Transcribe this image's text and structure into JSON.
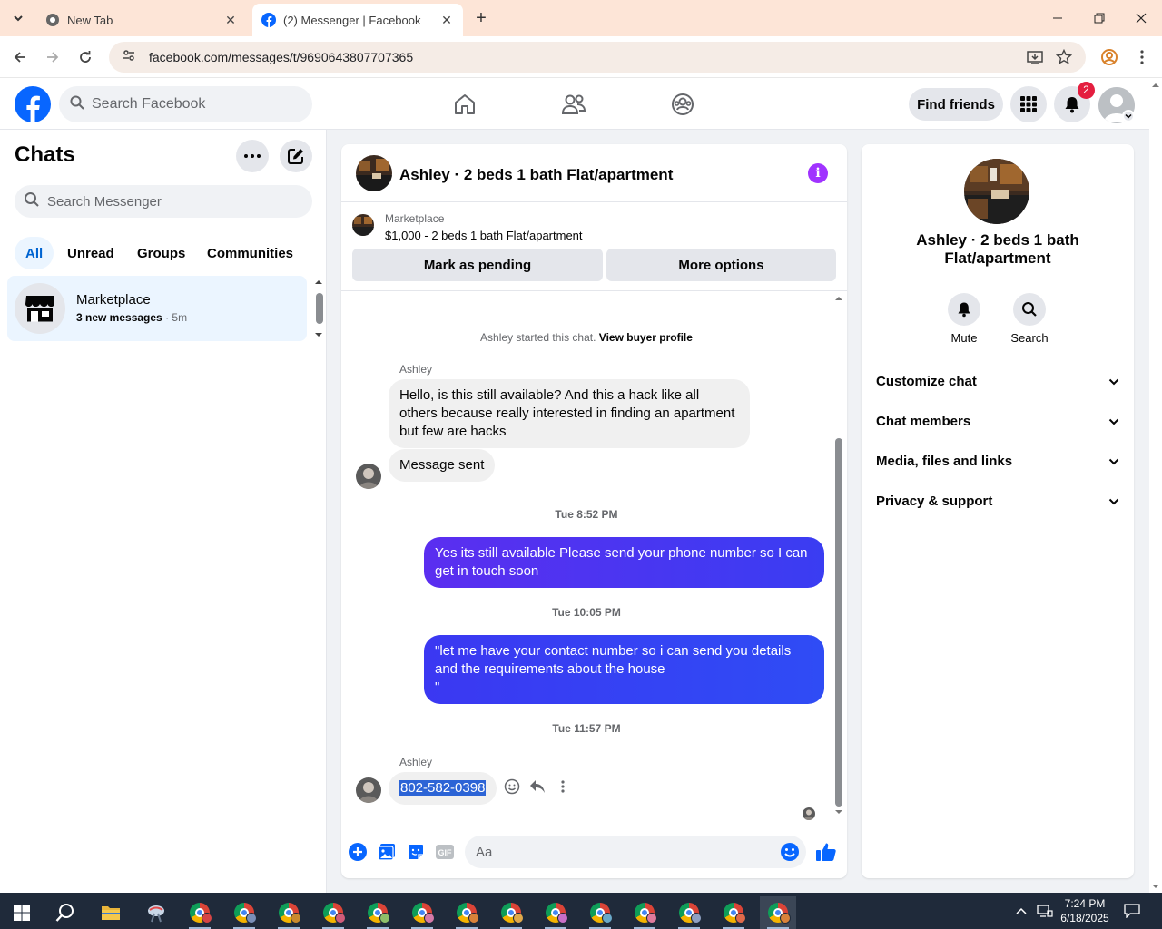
{
  "browser": {
    "tabs": [
      {
        "title": "New Tab",
        "active": false
      },
      {
        "title": "(2) Messenger | Facebook",
        "active": true
      }
    ],
    "url": "facebook.com/messages/t/9690643807707365"
  },
  "fb_header": {
    "search_placeholder": "Search Facebook",
    "find_friends": "Find friends",
    "notifications_count": "2"
  },
  "sidebar": {
    "title": "Chats",
    "search_placeholder": "Search Messenger",
    "filters": [
      "All",
      "Unread",
      "Groups",
      "Communities"
    ],
    "active_filter": "All",
    "chats": [
      {
        "name": "Marketplace",
        "preview": "3 new messages",
        "time": "· 5m"
      }
    ]
  },
  "conversation": {
    "title": "Ashley · 2 beds 1 bath Flat/apartment",
    "listing": {
      "label": "Marketplace",
      "price_title": "$1,000 - 2 beds 1 bath Flat/apartment",
      "buttons": [
        "Mark as pending",
        "More options"
      ]
    },
    "system_message": "Ashley started this chat.",
    "system_link": "View buyer profile",
    "messages": [
      {
        "sender": "Ashley",
        "text": "Hello, is this still available? And this a hack like all others because really interested in finding an apartment but few are hacks"
      },
      {
        "text": "Message sent"
      },
      {
        "timestamp": "Tue 8:52 PM"
      },
      {
        "outgoing": true,
        "text": "Yes its still available Please send your phone number so I can get in touch soon"
      },
      {
        "timestamp": "Tue 10:05 PM"
      },
      {
        "outgoing": true,
        "text": "\"let me have your contact number so i can send you details and the requirements about the house\n\""
      },
      {
        "timestamp": "Tue 11:57 PM"
      },
      {
        "sender": "Ashley",
        "text": "802-582-0398"
      }
    ],
    "composer_placeholder": "Aa"
  },
  "info_panel": {
    "name": "Ashley · 2 beds 1 bath Flat/apartment",
    "actions": [
      "Mute",
      "Search"
    ],
    "sections": [
      "Customize chat",
      "Chat members",
      "Media, files and links",
      "Privacy & support"
    ]
  },
  "taskbar": {
    "time": "7:24 PM",
    "date": "6/18/2025"
  },
  "colors": {
    "fb_blue": "#0866ff",
    "messenger_purple": "#5b2ef0",
    "info_purple": "#a033ff",
    "tabbar": "#fde5d7"
  }
}
